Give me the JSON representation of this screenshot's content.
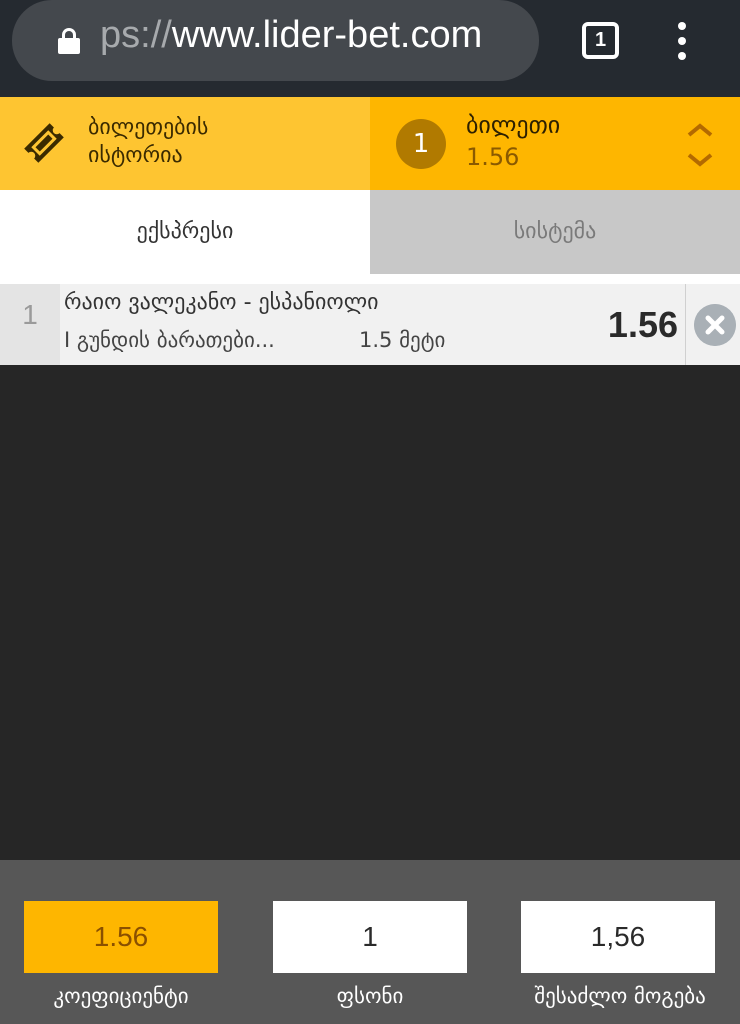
{
  "browser": {
    "url_scheme": "ps://",
    "url_host": "www.lider-bet.com",
    "tab_count": "1",
    "icons": [
      "lock-icon",
      "tabs-icon",
      "menu-icon"
    ]
  },
  "header": {
    "history_label_line1": "ბილეთების",
    "history_label_line2": "ისტორია",
    "ticket_count": "1",
    "ticket_title": "ბილეთი",
    "ticket_odds": "1.56"
  },
  "tabs": {
    "express": "ექსპრესი",
    "system": "სისტემა",
    "active": "express"
  },
  "bets": [
    {
      "index": "1",
      "match": "რაიო ვალეკანო - ესპანიოლი",
      "market": "I გუნდის ბარათები...",
      "selection": "1.5 მეტი",
      "odds": "1.56"
    }
  ],
  "footer": {
    "coefficient_value": "1.56",
    "coefficient_label": "კოეფიციენტი",
    "stake_value": "1",
    "stake_label": "ფსონი",
    "win_value": "1,56",
    "win_label": "შესაძლო მოგება"
  },
  "colors": {
    "accent_yellow": "#feb600",
    "light_yellow": "#fec531",
    "background_dark": "#262626",
    "footer_gray": "#575757"
  }
}
